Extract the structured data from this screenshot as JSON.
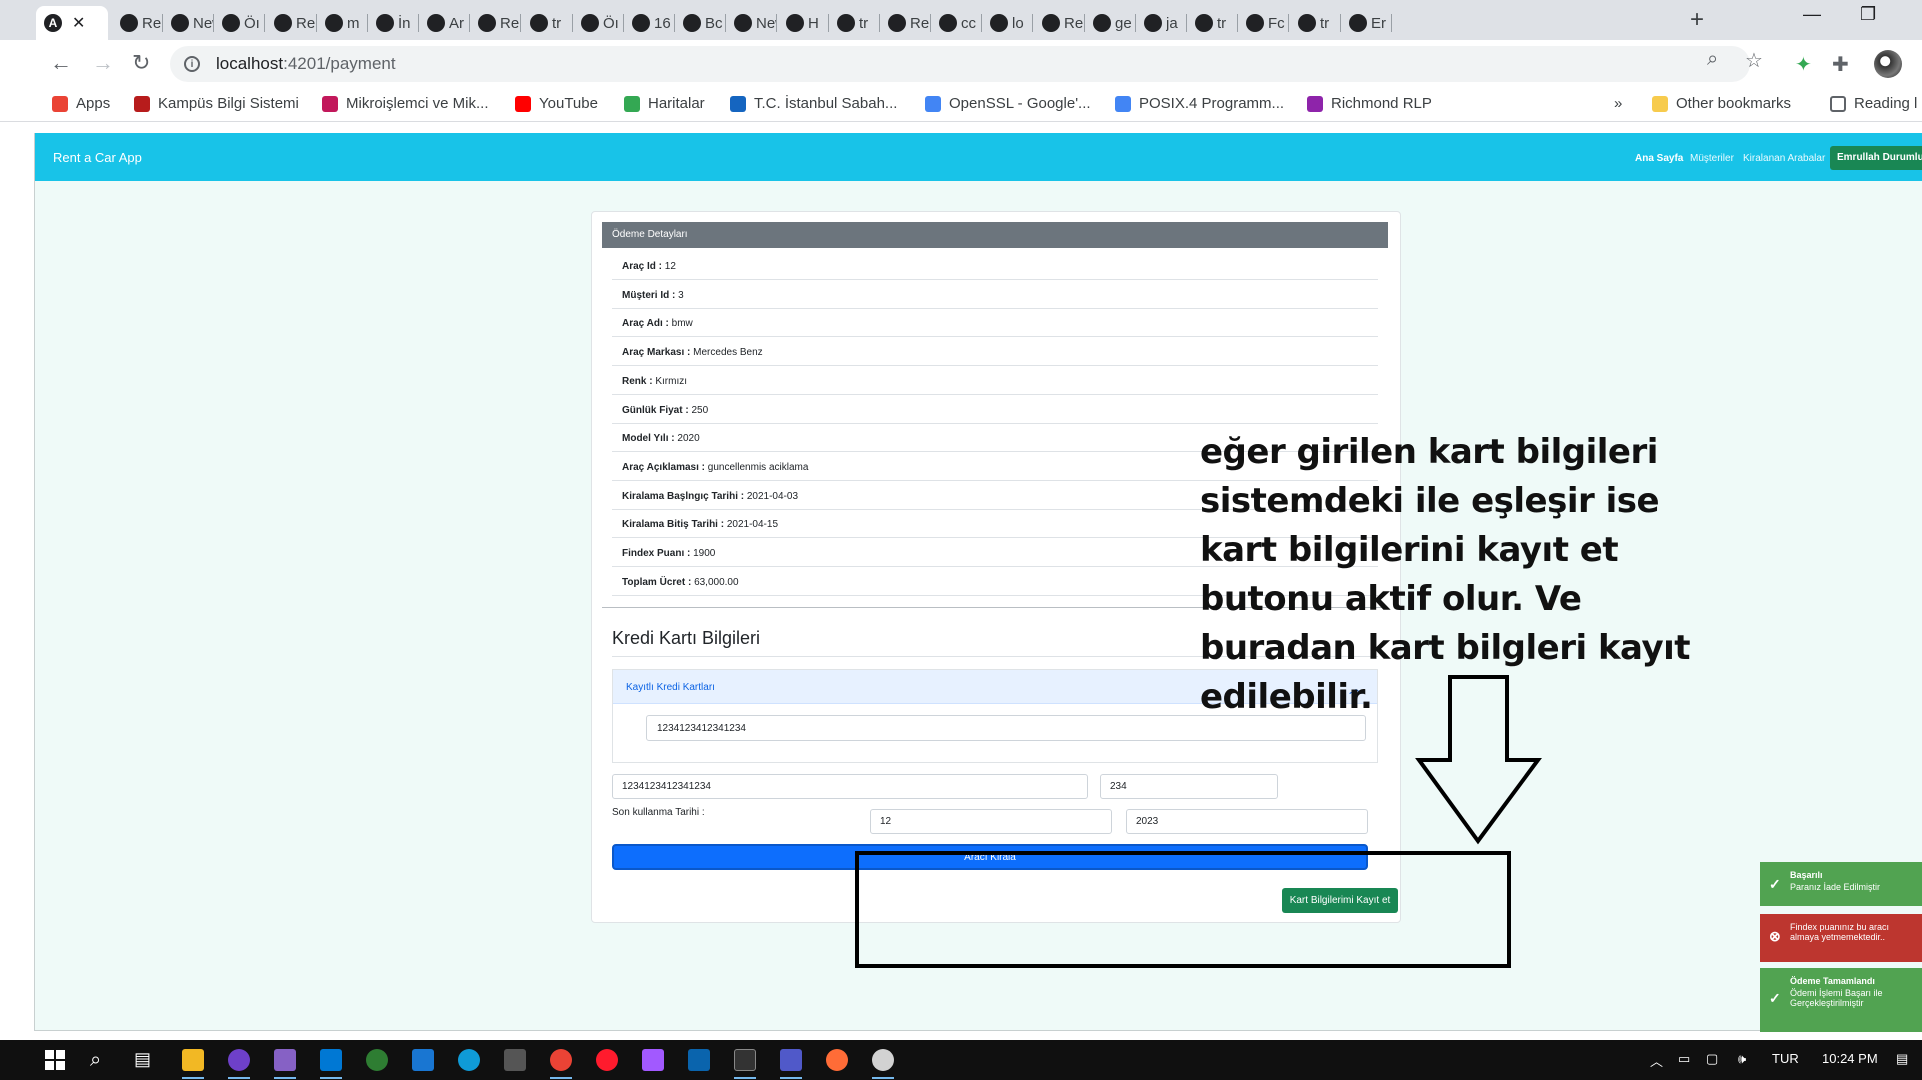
{
  "browser": {
    "tabs": [
      {
        "label": "",
        "active": true
      },
      {
        "label": "Re"
      },
      {
        "label": "New T"
      },
      {
        "label": "Öı"
      },
      {
        "label": "Re"
      },
      {
        "label": "m"
      },
      {
        "label": "İn"
      },
      {
        "label": "Ar"
      },
      {
        "label": "Re"
      },
      {
        "label": "tr"
      },
      {
        "label": "Öı"
      },
      {
        "label": "16"
      },
      {
        "label": "Bc"
      },
      {
        "label": "New T"
      },
      {
        "label": "H"
      },
      {
        "label": "tr"
      },
      {
        "label": "Re"
      },
      {
        "label": "cc"
      },
      {
        "label": "lo"
      },
      {
        "label": "Re"
      },
      {
        "label": "ge"
      },
      {
        "label": "ja"
      },
      {
        "label": "tr"
      },
      {
        "label": "Fc"
      },
      {
        "label": "tr"
      },
      {
        "label": "Er"
      }
    ],
    "url_host": "localhost",
    "url_path": ":4201/payment",
    "bookmarks": [
      {
        "label": "Apps",
        "color": "#ea4335"
      },
      {
        "label": "Kampüs Bilgi Sistemi",
        "color": "#b71c1c"
      },
      {
        "label": "Mikroişlemci ve Mik...",
        "color": "#c2185b"
      },
      {
        "label": "YouTube",
        "color": "#ff0000"
      },
      {
        "label": "Haritalar",
        "color": "#34a853"
      },
      {
        "label": "T.C. İstanbul Sabah...",
        "color": "#1565c0"
      },
      {
        "label": "OpenSSL - Google'...",
        "color": "#4285f4"
      },
      {
        "label": "POSIX.4 Programm...",
        "color": "#4285f4"
      },
      {
        "label": "Richmond RLP",
        "color": "#8e24aa"
      }
    ],
    "more_bookmarks": "»",
    "other_bookmarks": "Other bookmarks",
    "reading_list": "Reading l"
  },
  "app": {
    "brand": "Rent a Car App",
    "nav": [
      "Ana Sayfa",
      "Müşteriler",
      "Kiralanan Arabalar"
    ],
    "user_button": "Emrullah Durumlu"
  },
  "payment": {
    "header": "Ödeme Detayları",
    "details": [
      {
        "label": "Araç Id :",
        "value": "12"
      },
      {
        "label": "Müşteri Id :",
        "value": "3"
      },
      {
        "label": "Araç Adı :",
        "value": "bmw"
      },
      {
        "label": "Araç Markası :",
        "value": "Mercedes Benz"
      },
      {
        "label": "Renk :",
        "value": "Kırmızı"
      },
      {
        "label": "Günlük Fiyat :",
        "value": "250"
      },
      {
        "label": "Model Yılı :",
        "value": "2020"
      },
      {
        "label": "Araç Açıklaması :",
        "value": "guncellenmis aciklama"
      },
      {
        "label": "Kiralama Başlngıç Tarihi :",
        "value": "2021-04-03"
      },
      {
        "label": "Kiralama Bitiş Tarihi :",
        "value": "2021-04-15"
      },
      {
        "label": "Findex Puanı :",
        "value": "1900"
      },
      {
        "label": "Toplam Ücret :",
        "value": "63,000.00"
      }
    ]
  },
  "card_form": {
    "title": "Kredi Kartı Bilgileri",
    "saved_cards_header": "Kayıtlı Kredi Kartları",
    "saved_card": "1234123412341234",
    "card_number": "1234123412341234",
    "cvv": "234",
    "expiry_label": "Son kullanma Tarihi :",
    "expiry_month": "12",
    "expiry_year": "2023",
    "rent_button": "Aracı Kirala",
    "save_button": "Kart Bilgilerimi Kayıt et"
  },
  "annotation": {
    "text": "eğer girilen kart bilgileri sistemdeki ile eşleşir ise kart bilgilerini kayıt et butonu aktif olur. Ve buradan kart bilgleri kayıt edilebilir."
  },
  "toasts": [
    {
      "type": "success",
      "title": "Başarılı",
      "message": "Paranız İade Edilmiştir"
    },
    {
      "type": "error",
      "title": "",
      "message": "Findex puanınız bu aracı almaya yetmemektedir.."
    },
    {
      "type": "success",
      "title": "Ödeme Tamamlandı",
      "message": "Ödemi İşlemi Başarı ile Gerçekleştirilmiştir"
    }
  ],
  "taskbar": {
    "language": "TUR",
    "time": "10:24 PM"
  }
}
